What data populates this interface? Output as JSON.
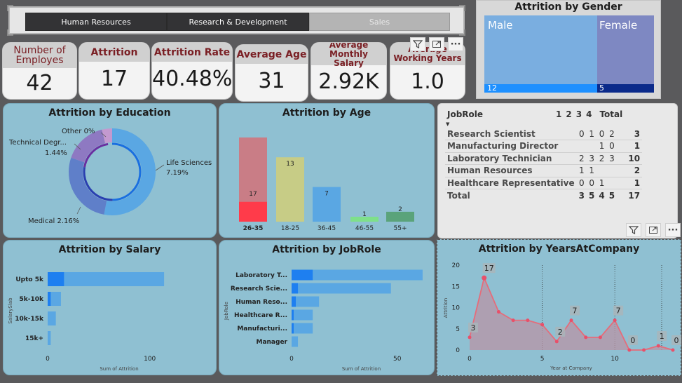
{
  "slicer": {
    "buttons": [
      {
        "label": "Human Resources",
        "state": "selected"
      },
      {
        "label": "Research & Development",
        "state": "selected"
      },
      {
        "label": "Sales",
        "state": "unselected"
      }
    ]
  },
  "kpis": [
    {
      "title": "Number of Employes",
      "value": "42"
    },
    {
      "title": "Attrition",
      "value": "17"
    },
    {
      "title": "Attrition Rate",
      "value": "40.48%"
    },
    {
      "title": "Average Age",
      "value": "31"
    },
    {
      "title": "Average Monthly Salary",
      "value": "2.92K"
    },
    {
      "title": "Average Working Years",
      "value": "1.0"
    }
  ],
  "gender": {
    "title": "Attrition by Gender",
    "male_label": "Male",
    "female_label": "Female",
    "male_value": "12",
    "female_value": "5",
    "colors": {
      "male": "#7aaee0",
      "female": "#7e88c2",
      "male_bar": "#1e90ff",
      "female_bar": "#0b2a8a"
    }
  },
  "education": {
    "title": "Attrition by Education",
    "labels": {
      "other": "Other 0%",
      "technical": "Technical Degr...",
      "technical_pct": "1.44%",
      "life": "Life Sciences",
      "life_pct": "7.19%",
      "medical": "Medical 2.16%"
    }
  },
  "age": {
    "title": "Attrition by Age",
    "categories": [
      "26-35",
      "18-25",
      "36-45",
      "46-55",
      "55+"
    ],
    "totals": [
      17,
      13,
      7,
      1,
      2
    ],
    "highlight": [
      4,
      0,
      0,
      0,
      0
    ],
    "colors": [
      "#c97d86",
      "#c7cc86",
      "#5aa7e3",
      "#7ee08a",
      "#5aa37a"
    ],
    "highlight_color": "#ff3b4a"
  },
  "jobrole_table": {
    "header": "JobRole",
    "cols": [
      "1",
      "2",
      "3",
      "4",
      "Total"
    ],
    "rows": [
      {
        "role": "Research Scientist",
        "v": [
          "0",
          "1",
          "0",
          "2"
        ],
        "total": "3"
      },
      {
        "role": "Manufacturing Director",
        "v": [
          "",
          "",
          "1",
          "0"
        ],
        "total": "1"
      },
      {
        "role": "Laboratory Technician",
        "v": [
          "2",
          "3",
          "2",
          "3"
        ],
        "total": "10"
      },
      {
        "role": "Human Resources",
        "v": [
          "1",
          "1",
          "",
          ""
        ],
        "total": "2"
      },
      {
        "role": "Healthcare Representative",
        "v": [
          "0",
          "0",
          "1",
          ""
        ],
        "total": "1"
      }
    ],
    "total_row": {
      "role": "Total",
      "v": [
        "3",
        "5",
        "4",
        "5"
      ],
      "total": "17"
    }
  },
  "salary": {
    "title": "Attrition by Salary",
    "ylabel": "SalarySlab",
    "xlabel": "Sum of Attrition",
    "categories": [
      "Upto 5k",
      "5k-10k",
      "10k-15k",
      "15k+"
    ],
    "values": [
      114,
      13,
      8,
      3
    ],
    "highlight": [
      16,
      3,
      0,
      0
    ],
    "xticks": [
      "0",
      "100"
    ],
    "xmax": 140
  },
  "jobrole": {
    "title": "Attrition by JobRole",
    "ylabel": "JobRole",
    "xlabel": "Sum of Attrition",
    "categories": [
      "Laboratory T...",
      "Research Scie...",
      "Human Reso...",
      "Healthcare R...",
      "Manufacturi...",
      "Manager"
    ],
    "values": [
      62,
      47,
      13,
      10,
      10,
      3
    ],
    "highlight": [
      10,
      3,
      2,
      1,
      1,
      0
    ],
    "xticks": [
      "0",
      "50"
    ],
    "xmax": 66
  },
  "years": {
    "title": "Attrition by YearsAtCompany",
    "ylabel": "Attrition",
    "xlabel": "Year at Company",
    "yticks": [
      "0",
      "5",
      "10",
      "15",
      "20"
    ],
    "xticks": [
      "0",
      "5",
      "10"
    ],
    "chart_data": {
      "type": "line",
      "x": [
        0,
        1,
        2,
        3,
        4,
        5,
        6,
        7,
        8,
        9,
        10,
        11,
        12,
        13,
        14
      ],
      "y": [
        3,
        17,
        9,
        7,
        7,
        6,
        2,
        7,
        3,
        3,
        7,
        0,
        0,
        1,
        0
      ],
      "ylim": [
        0,
        20
      ],
      "xlim": [
        0,
        14
      ]
    },
    "data_labels": [
      {
        "x": 0,
        "label": "3"
      },
      {
        "x": 1,
        "label": "17"
      },
      {
        "x": 6,
        "label": "2"
      },
      {
        "x": 7,
        "label": "7"
      },
      {
        "x": 10,
        "label": "7"
      },
      {
        "x": 11,
        "label": "0"
      },
      {
        "x": 13,
        "label": "1"
      },
      {
        "x": 14,
        "label": "0"
      }
    ]
  },
  "icons": {
    "filter": "filter-icon",
    "focus": "focus-mode-icon",
    "more": "more-options-icon"
  }
}
